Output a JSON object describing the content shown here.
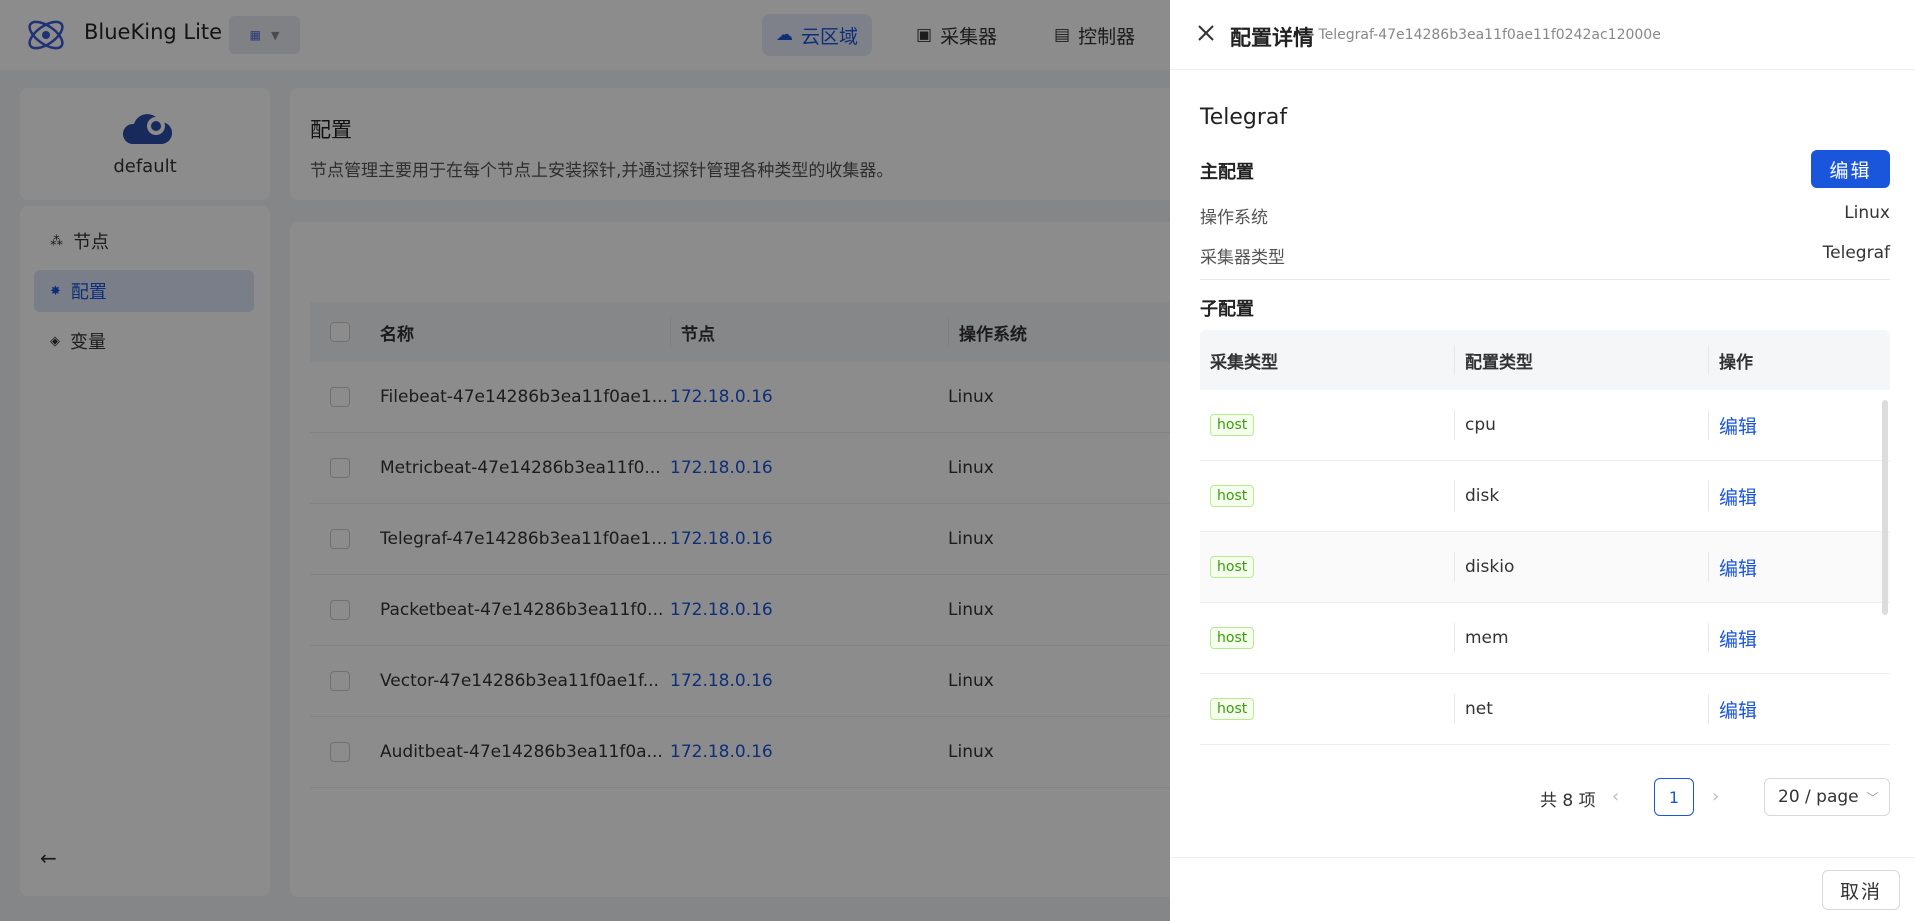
{
  "header": {
    "brand": "BlueKing Lite",
    "nav": [
      {
        "label": "云区域",
        "icon": "cloud-icon",
        "active": true
      },
      {
        "label": "采集器",
        "icon": "collector-icon",
        "active": false
      },
      {
        "label": "控制器",
        "icon": "controller-icon",
        "active": false
      }
    ]
  },
  "cloud_region": {
    "name": "default"
  },
  "sidebar": {
    "items": [
      {
        "label": "节点",
        "icon": "node-icon",
        "active": false
      },
      {
        "label": "配置",
        "icon": "gear-icon",
        "active": true
      },
      {
        "label": "变量",
        "icon": "layers-icon",
        "active": false
      }
    ]
  },
  "page": {
    "title": "配置",
    "description": "节点管理主要用于在每个节点上安装探针,并通过探针管理各种类型的收集器。"
  },
  "table": {
    "columns": [
      "名称",
      "节点",
      "操作系统"
    ],
    "rows": [
      {
        "name": "Filebeat-47e14286b3ea11f0ae1...",
        "node": "172.18.0.16",
        "os": "Linux"
      },
      {
        "name": "Metricbeat-47e14286b3ea11f0...",
        "node": "172.18.0.16",
        "os": "Linux"
      },
      {
        "name": "Telegraf-47e14286b3ea11f0ae1...",
        "node": "172.18.0.16",
        "os": "Linux"
      },
      {
        "name": "Packetbeat-47e14286b3ea11f0...",
        "node": "172.18.0.16",
        "os": "Linux"
      },
      {
        "name": "Vector-47e14286b3ea11f0ae1f...",
        "node": "172.18.0.16",
        "os": "Linux"
      },
      {
        "name": "Auditbeat-47e14286b3ea11f0a...",
        "node": "172.18.0.16",
        "os": "Linux"
      }
    ]
  },
  "drawer": {
    "title": "配置详情",
    "subtitle": "- Telegraf-47e14286b3ea11f0ae11f0242ac12000e",
    "config_name": "Telegraf",
    "main_section": "主配置",
    "edit_label": "编辑",
    "os_label": "操作系统",
    "os_value": "Linux",
    "collector_type_label": "采集器类型",
    "collector_type_value": "Telegraf",
    "sub_section": "子配置",
    "sub_columns": [
      "采集类型",
      "配置类型",
      "操作"
    ],
    "sub_rows": [
      {
        "tag": "host",
        "type": "cpu",
        "action": "编辑"
      },
      {
        "tag": "host",
        "type": "disk",
        "action": "编辑"
      },
      {
        "tag": "host",
        "type": "diskio",
        "action": "编辑"
      },
      {
        "tag": "host",
        "type": "mem",
        "action": "编辑"
      },
      {
        "tag": "host",
        "type": "net",
        "action": "编辑"
      }
    ],
    "pagination": {
      "total": "共 8 项",
      "prev": "‹",
      "current": "1",
      "next": "›",
      "page_size": "20 / page"
    },
    "cancel_label": "取消"
  }
}
